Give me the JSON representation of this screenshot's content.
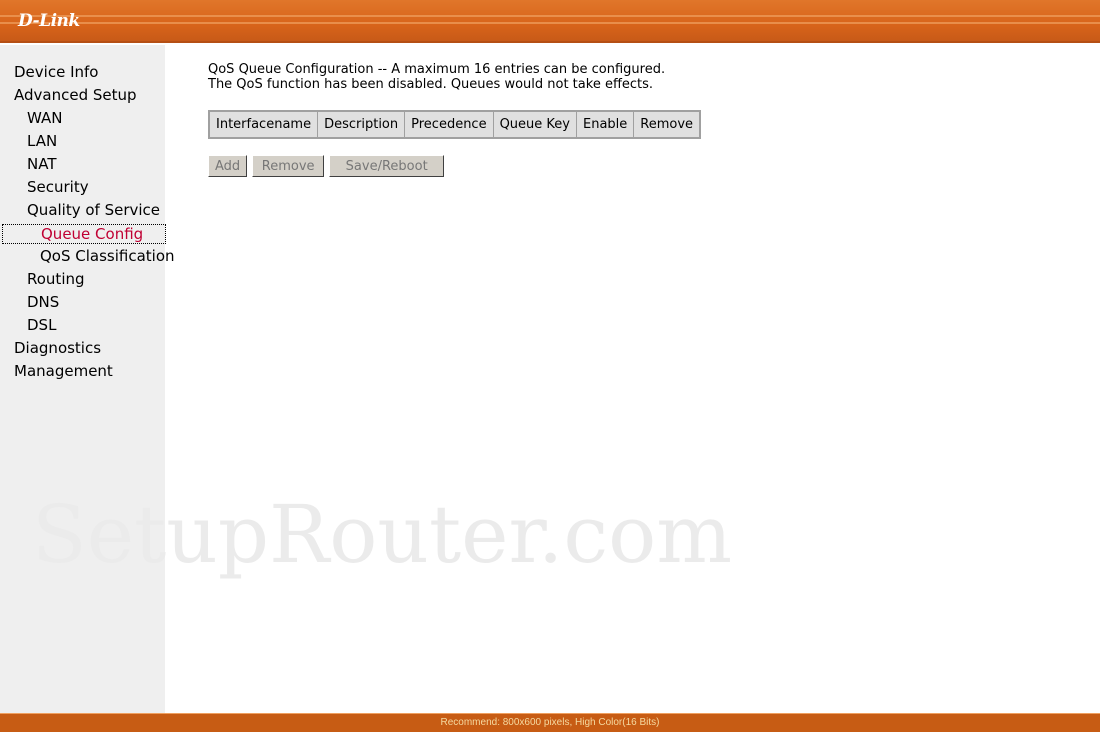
{
  "header": {
    "logo": "D-Link"
  },
  "sidebar": {
    "items": [
      {
        "label": "Device Info",
        "level": 0
      },
      {
        "label": "Advanced Setup",
        "level": 0
      },
      {
        "label": "WAN",
        "level": 1
      },
      {
        "label": "LAN",
        "level": 1
      },
      {
        "label": "NAT",
        "level": 1
      },
      {
        "label": "Security",
        "level": 1
      },
      {
        "label": "Quality of Service",
        "level": 1
      },
      {
        "label": "Queue Config",
        "level": 2,
        "selected": true
      },
      {
        "label": "QoS Classification",
        "level": 2
      },
      {
        "label": "Routing",
        "level": 1
      },
      {
        "label": "DNS",
        "level": 1
      },
      {
        "label": "DSL",
        "level": 1
      },
      {
        "label": "Diagnostics",
        "level": 0
      },
      {
        "label": "Management",
        "level": 0
      }
    ]
  },
  "main": {
    "line1": "QoS Queue Configuration -- A maximum 16 entries can be configured.",
    "line2": "The QoS function has been disabled. Queues would not take effects.",
    "columns": [
      "Interfacename",
      "Description",
      "Precedence",
      "Queue Key",
      "Enable",
      "Remove"
    ],
    "buttons": {
      "add": "Add",
      "remove": "Remove",
      "save": "Save/Reboot"
    }
  },
  "watermark": "SetupRouter.com",
  "footer": "Recommend: 800x600 pixels, High Color(16 Bits)",
  "colors": {
    "brand": "#d8641a",
    "selected": "#c00033"
  }
}
